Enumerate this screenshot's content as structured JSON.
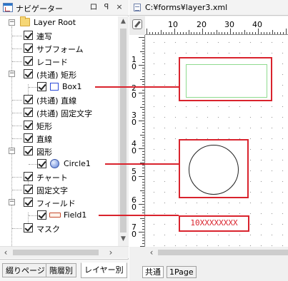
{
  "navigator": {
    "title": "ナビゲーター",
    "buttons": {
      "restore": "ロ",
      "pin": "ꟼ",
      "close": "×"
    },
    "tree": [
      {
        "label": "Layer Root"
      },
      {
        "label": "連写"
      },
      {
        "label": "サブフォーム"
      },
      {
        "label": "レコード"
      },
      {
        "label": "(共通) 矩形"
      },
      {
        "label": "Box1"
      },
      {
        "label": "(共通) 直線"
      },
      {
        "label": "(共通) 固定文字"
      },
      {
        "label": "矩形"
      },
      {
        "label": "直線"
      },
      {
        "label": "図形"
      },
      {
        "label": "Circle1"
      },
      {
        "label": "チャート"
      },
      {
        "label": "固定文字"
      },
      {
        "label": "フィールド"
      },
      {
        "label": "Field1"
      },
      {
        "label": "マスク"
      }
    ],
    "tabs": [
      "綴りページ",
      "階層別",
      "レイヤー別"
    ],
    "active_tab": "レイヤー別"
  },
  "editor": {
    "path": "C:¥forms¥layer3.xml",
    "ruler_top": [
      "10",
      "20",
      "30",
      "40"
    ],
    "ruler_left": [
      "1\n0",
      "2\n0",
      "3\n0",
      "4\n0",
      "5\n0",
      "6\n0",
      "7\n0"
    ],
    "field_text": "10XXXXXXXX",
    "tabs": [
      "共通",
      "1Page"
    ],
    "active_tab": "共通"
  },
  "colors": {
    "selection": "#d9232d",
    "box_inner": "#8fdb8f",
    "accent": "#2b76c9"
  }
}
